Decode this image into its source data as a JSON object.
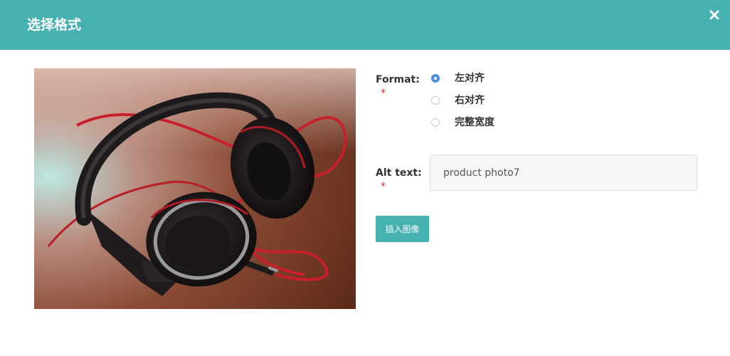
{
  "dialog": {
    "title": "选择格式",
    "close_icon": "close-icon",
    "accent_color": "#45b1b1"
  },
  "image": {
    "subject": "headphones-photo"
  },
  "form": {
    "format_label": "Format:",
    "required_marker": "*",
    "format_options": [
      {
        "label": "左对齐",
        "checked": true
      },
      {
        "label": "右对齐",
        "checked": false
      },
      {
        "label": "完整宽度",
        "checked": false
      }
    ],
    "alt_label": "Alt text:",
    "alt_value": "product photo7",
    "insert_button": "插入图像"
  }
}
